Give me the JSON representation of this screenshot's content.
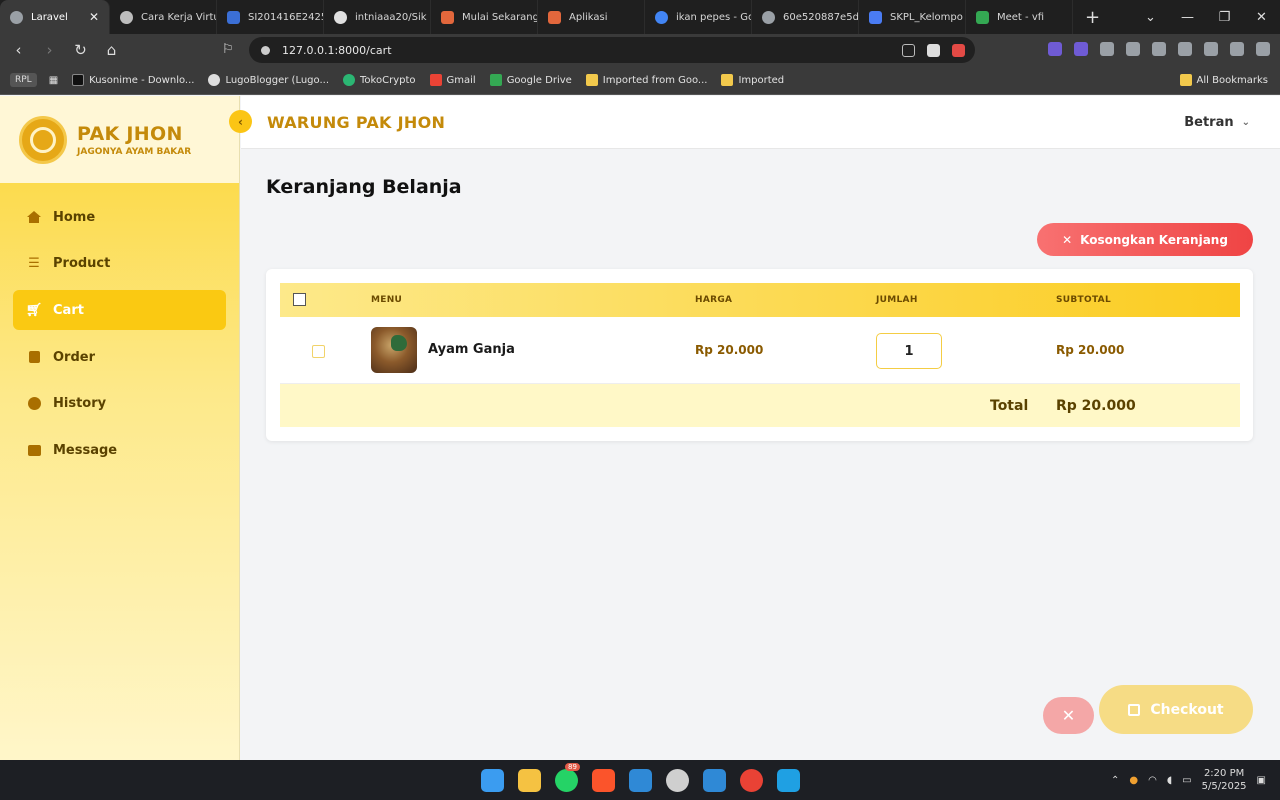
{
  "browser": {
    "tabs": [
      {
        "label": "Laravel",
        "active": true,
        "color": "#9aa0a6"
      },
      {
        "label": "Cara Kerja Virtu",
        "color": "#bdbdbd"
      },
      {
        "label": "SI201416E2425",
        "color": "#3b6fd6"
      },
      {
        "label": "intniaaa20/Sik",
        "color": "#e0e0e0"
      },
      {
        "label": "Mulai Sekarang",
        "color": "#e2673c"
      },
      {
        "label": "Aplikasi",
        "color": "#e2673c"
      },
      {
        "label": "ikan pepes - Go",
        "color": "#4285f4"
      },
      {
        "label": "60e520887e5d",
        "color": "#9aa0a6"
      },
      {
        "label": "SKPL_Kelompo",
        "color": "#4a7cf3"
      },
      {
        "label": "Meet - vfi",
        "color": "#34a853"
      }
    ],
    "tab_close": "✕",
    "new_tab": "+",
    "url": "127.0.0.1:8000/cart",
    "bookmarks": [
      {
        "label": "Kusonime - Downlo...",
        "color": "#111"
      },
      {
        "label": "LugoBlogger (Lugo...",
        "color": "#ddd"
      },
      {
        "label": "TokoCrypto",
        "color": "#2bb673"
      },
      {
        "label": "Gmail",
        "color": "#ea4335"
      },
      {
        "label": "Google Drive",
        "color": "#34a853"
      },
      {
        "label": "Imported from Goo...",
        "color": "#f2c94c"
      },
      {
        "label": "Imported",
        "color": "#f2c94c"
      }
    ],
    "bookmark_rpl": "RPL",
    "all_bookmarks": "All Bookmarks"
  },
  "brand": {
    "name": "PAK JHON",
    "tagline": "JAGONYA AYAM BAKAR"
  },
  "sidebar": {
    "items": [
      {
        "label": "Home",
        "icon": "home-icon"
      },
      {
        "label": "Product",
        "icon": "list-icon"
      },
      {
        "label": "Cart",
        "icon": "cart-icon",
        "active": true
      },
      {
        "label": "Order",
        "icon": "bag-icon"
      },
      {
        "label": "History",
        "icon": "clock-icon"
      },
      {
        "label": "Message",
        "icon": "message-icon"
      }
    ]
  },
  "topbar": {
    "title": "WARUNG PAK JHON",
    "user": "Betran"
  },
  "page": {
    "title": "Keranjang Belanja",
    "clear_button": "Kosongkan Keranjang"
  },
  "table": {
    "headers": {
      "menu": "MENU",
      "harga": "HARGA",
      "jumlah": "JUMLAH",
      "subtotal": "SUBTOTAL"
    },
    "rows": [
      {
        "name": "Ayam Ganja",
        "price": "Rp 20.000",
        "qty": "1",
        "subtotal": "Rp 20.000"
      }
    ],
    "total_label": "Total",
    "total_value": "Rp 20.000"
  },
  "actions": {
    "checkout": "Checkout"
  },
  "taskbar": {
    "whatsapp_badge": "89",
    "time": "2:20 PM",
    "date": "5/5/2025"
  },
  "colors": {
    "accent": "#fac912",
    "brand": "#c48a0a",
    "danger": "#ef4444"
  }
}
